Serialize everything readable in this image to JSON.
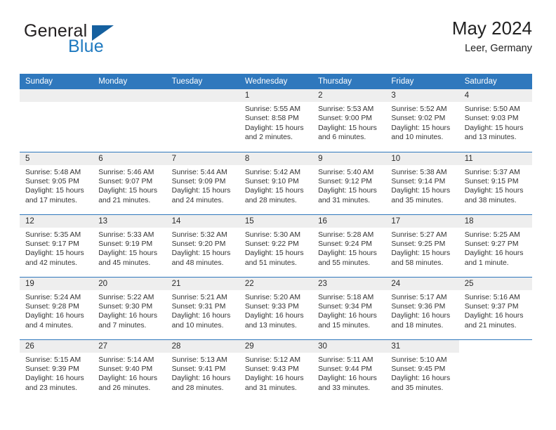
{
  "brand": {
    "name_part1": "General",
    "name_part2": "Blue",
    "logo_icon": "blue-triangle-icon",
    "colors": {
      "dark_text": "#231f20",
      "blue_text": "#1f7ac0",
      "triangle": "#15609f"
    }
  },
  "header": {
    "title": "May 2024",
    "subtitle": "Leer, Germany"
  },
  "theme": {
    "header_row_bg": "#2f78bd",
    "daynum_bg": "#eeeeee",
    "row_divider": "#2f78bd",
    "cell_bg": "#ffffff"
  },
  "weekdays": [
    "Sunday",
    "Monday",
    "Tuesday",
    "Wednesday",
    "Thursday",
    "Friday",
    "Saturday"
  ],
  "labels": {
    "sunrise_prefix": "Sunrise:",
    "sunset_prefix": "Sunset:",
    "daylight_prefix": "Daylight:"
  },
  "weeks": [
    [
      {
        "day": "",
        "empty": true
      },
      {
        "day": "",
        "empty": true
      },
      {
        "day": "",
        "empty": true
      },
      {
        "day": "1",
        "sunrise": "Sunrise: 5:55 AM",
        "sunset": "Sunset: 8:58 PM",
        "daylight": "Daylight: 15 hours and 2 minutes."
      },
      {
        "day": "2",
        "sunrise": "Sunrise: 5:53 AM",
        "sunset": "Sunset: 9:00 PM",
        "daylight": "Daylight: 15 hours and 6 minutes."
      },
      {
        "day": "3",
        "sunrise": "Sunrise: 5:52 AM",
        "sunset": "Sunset: 9:02 PM",
        "daylight": "Daylight: 15 hours and 10 minutes."
      },
      {
        "day": "4",
        "sunrise": "Sunrise: 5:50 AM",
        "sunset": "Sunset: 9:03 PM",
        "daylight": "Daylight: 15 hours and 13 minutes."
      }
    ],
    [
      {
        "day": "5",
        "sunrise": "Sunrise: 5:48 AM",
        "sunset": "Sunset: 9:05 PM",
        "daylight": "Daylight: 15 hours and 17 minutes."
      },
      {
        "day": "6",
        "sunrise": "Sunrise: 5:46 AM",
        "sunset": "Sunset: 9:07 PM",
        "daylight": "Daylight: 15 hours and 21 minutes."
      },
      {
        "day": "7",
        "sunrise": "Sunrise: 5:44 AM",
        "sunset": "Sunset: 9:09 PM",
        "daylight": "Daylight: 15 hours and 24 minutes."
      },
      {
        "day": "8",
        "sunrise": "Sunrise: 5:42 AM",
        "sunset": "Sunset: 9:10 PM",
        "daylight": "Daylight: 15 hours and 28 minutes."
      },
      {
        "day": "9",
        "sunrise": "Sunrise: 5:40 AM",
        "sunset": "Sunset: 9:12 PM",
        "daylight": "Daylight: 15 hours and 31 minutes."
      },
      {
        "day": "10",
        "sunrise": "Sunrise: 5:38 AM",
        "sunset": "Sunset: 9:14 PM",
        "daylight": "Daylight: 15 hours and 35 minutes."
      },
      {
        "day": "11",
        "sunrise": "Sunrise: 5:37 AM",
        "sunset": "Sunset: 9:15 PM",
        "daylight": "Daylight: 15 hours and 38 minutes."
      }
    ],
    [
      {
        "day": "12",
        "sunrise": "Sunrise: 5:35 AM",
        "sunset": "Sunset: 9:17 PM",
        "daylight": "Daylight: 15 hours and 42 minutes."
      },
      {
        "day": "13",
        "sunrise": "Sunrise: 5:33 AM",
        "sunset": "Sunset: 9:19 PM",
        "daylight": "Daylight: 15 hours and 45 minutes."
      },
      {
        "day": "14",
        "sunrise": "Sunrise: 5:32 AM",
        "sunset": "Sunset: 9:20 PM",
        "daylight": "Daylight: 15 hours and 48 minutes."
      },
      {
        "day": "15",
        "sunrise": "Sunrise: 5:30 AM",
        "sunset": "Sunset: 9:22 PM",
        "daylight": "Daylight: 15 hours and 51 minutes."
      },
      {
        "day": "16",
        "sunrise": "Sunrise: 5:28 AM",
        "sunset": "Sunset: 9:24 PM",
        "daylight": "Daylight: 15 hours and 55 minutes."
      },
      {
        "day": "17",
        "sunrise": "Sunrise: 5:27 AM",
        "sunset": "Sunset: 9:25 PM",
        "daylight": "Daylight: 15 hours and 58 minutes."
      },
      {
        "day": "18",
        "sunrise": "Sunrise: 5:25 AM",
        "sunset": "Sunset: 9:27 PM",
        "daylight": "Daylight: 16 hours and 1 minute."
      }
    ],
    [
      {
        "day": "19",
        "sunrise": "Sunrise: 5:24 AM",
        "sunset": "Sunset: 9:28 PM",
        "daylight": "Daylight: 16 hours and 4 minutes."
      },
      {
        "day": "20",
        "sunrise": "Sunrise: 5:22 AM",
        "sunset": "Sunset: 9:30 PM",
        "daylight": "Daylight: 16 hours and 7 minutes."
      },
      {
        "day": "21",
        "sunrise": "Sunrise: 5:21 AM",
        "sunset": "Sunset: 9:31 PM",
        "daylight": "Daylight: 16 hours and 10 minutes."
      },
      {
        "day": "22",
        "sunrise": "Sunrise: 5:20 AM",
        "sunset": "Sunset: 9:33 PM",
        "daylight": "Daylight: 16 hours and 13 minutes."
      },
      {
        "day": "23",
        "sunrise": "Sunrise: 5:18 AM",
        "sunset": "Sunset: 9:34 PM",
        "daylight": "Daylight: 16 hours and 15 minutes."
      },
      {
        "day": "24",
        "sunrise": "Sunrise: 5:17 AM",
        "sunset": "Sunset: 9:36 PM",
        "daylight": "Daylight: 16 hours and 18 minutes."
      },
      {
        "day": "25",
        "sunrise": "Sunrise: 5:16 AM",
        "sunset": "Sunset: 9:37 PM",
        "daylight": "Daylight: 16 hours and 21 minutes."
      }
    ],
    [
      {
        "day": "26",
        "sunrise": "Sunrise: 5:15 AM",
        "sunset": "Sunset: 9:39 PM",
        "daylight": "Daylight: 16 hours and 23 minutes."
      },
      {
        "day": "27",
        "sunrise": "Sunrise: 5:14 AM",
        "sunset": "Sunset: 9:40 PM",
        "daylight": "Daylight: 16 hours and 26 minutes."
      },
      {
        "day": "28",
        "sunrise": "Sunrise: 5:13 AM",
        "sunset": "Sunset: 9:41 PM",
        "daylight": "Daylight: 16 hours and 28 minutes."
      },
      {
        "day": "29",
        "sunrise": "Sunrise: 5:12 AM",
        "sunset": "Sunset: 9:43 PM",
        "daylight": "Daylight: 16 hours and 31 minutes."
      },
      {
        "day": "30",
        "sunrise": "Sunrise: 5:11 AM",
        "sunset": "Sunset: 9:44 PM",
        "daylight": "Daylight: 16 hours and 33 minutes."
      },
      {
        "day": "31",
        "sunrise": "Sunrise: 5:10 AM",
        "sunset": "Sunset: 9:45 PM",
        "daylight": "Daylight: 16 hours and 35 minutes."
      },
      {
        "day": "",
        "empty": true,
        "blank": true
      }
    ]
  ]
}
